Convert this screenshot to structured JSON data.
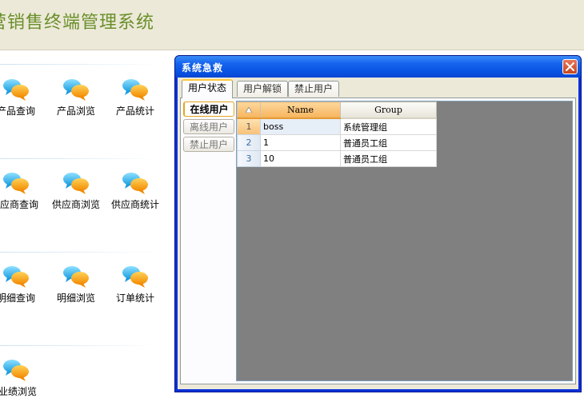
{
  "app": {
    "title": "营销售终端管理系统"
  },
  "tiles": [
    {
      "label": "产品查询"
    },
    {
      "label": "产品浏览"
    },
    {
      "label": "产品统计"
    },
    {
      "label": "供应商查询"
    },
    {
      "label": "供应商浏览"
    },
    {
      "label": "供应商统计"
    },
    {
      "label": "明细查询"
    },
    {
      "label": "明细浏览"
    },
    {
      "label": "订单统计"
    },
    {
      "label": "业绩浏览"
    }
  ],
  "dialog": {
    "title": "系统急救",
    "tabs": [
      {
        "label": "用户状态"
      },
      {
        "label": "用户解锁"
      },
      {
        "label": "禁止用户"
      }
    ],
    "side_buttons": [
      {
        "label": "在线用户"
      },
      {
        "label": "离线用户"
      },
      {
        "label": "禁止用户"
      }
    ],
    "grid": {
      "sort_icon": "sort-arrow-icon",
      "columns": [
        "Name",
        "Group"
      ],
      "rows": [
        {
          "num": "1",
          "name": "boss",
          "group": "系统管理组"
        },
        {
          "num": "2",
          "name": "1",
          "group": "普通员工组"
        },
        {
          "num": "3",
          "name": "10",
          "group": "普通员工组"
        }
      ]
    }
  },
  "colors": {
    "title_green": "#6a8f2a",
    "titlebar_blue": "#0a54e3",
    "grid_bg": "#808080",
    "sort_orange": "#f6b45c"
  }
}
